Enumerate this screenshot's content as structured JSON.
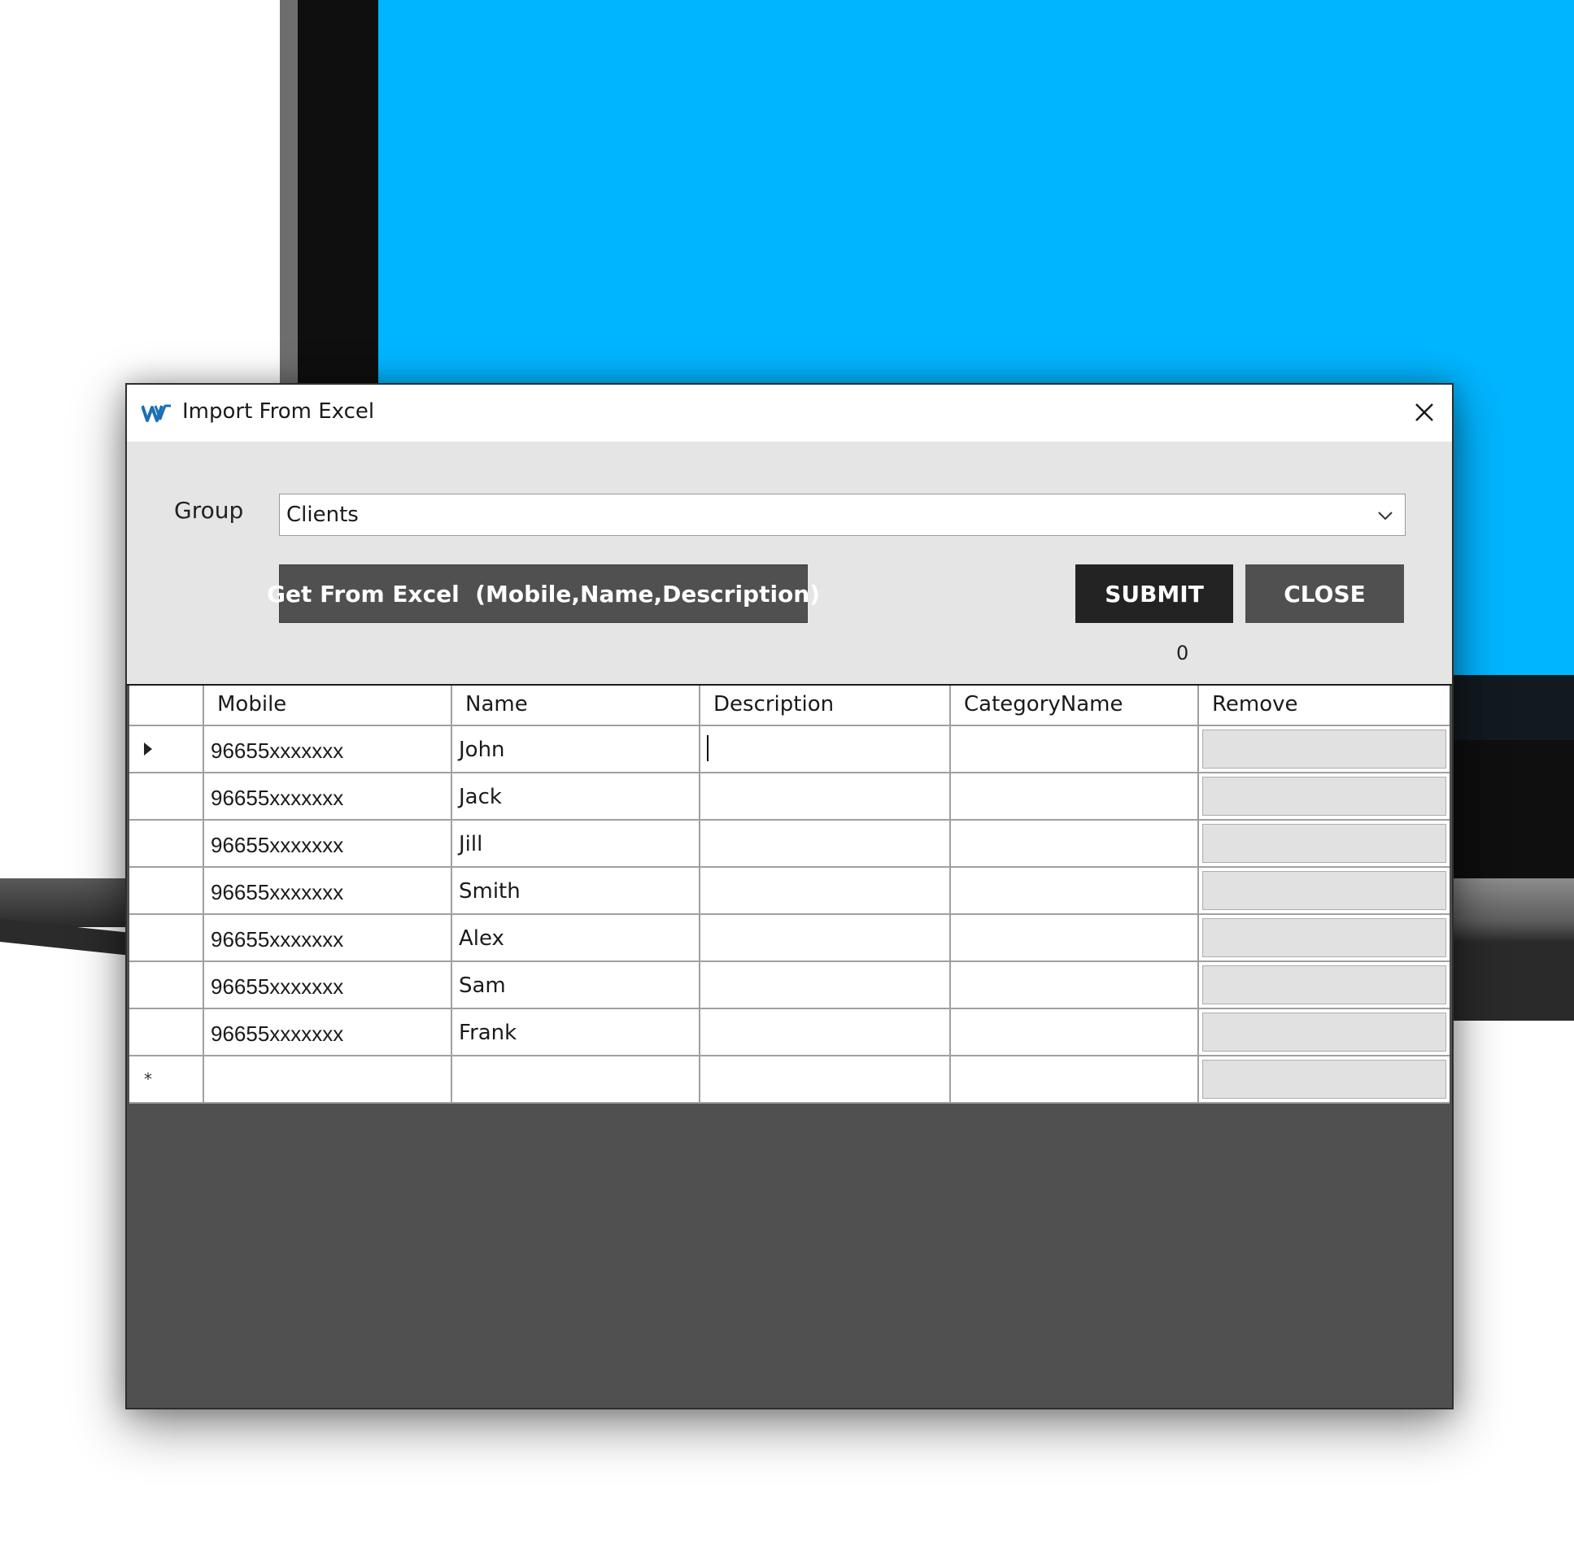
{
  "window": {
    "title": "Import From Excel",
    "app_icon": "ww-logo-icon",
    "close_icon": "close-icon"
  },
  "group": {
    "label": "Group",
    "selected": "Clients"
  },
  "buttons": {
    "get_from_excel": "Get From Excel  (Mobile,Name,Description)",
    "submit": "SUBMIT",
    "close": "CLOSE"
  },
  "counter": "0",
  "grid": {
    "columns": [
      "Mobile",
      "Name",
      "Description",
      "CategoryName",
      "Remove"
    ],
    "rows": [
      {
        "mobile": "96655xxxxxxx",
        "name": "John",
        "description": "",
        "category": ""
      },
      {
        "mobile": "96655xxxxxxx",
        "name": "Jack",
        "description": "",
        "category": ""
      },
      {
        "mobile": "96655xxxxxxx",
        "name": "Jill",
        "description": "",
        "category": ""
      },
      {
        "mobile": "96655xxxxxxx",
        "name": "Smith",
        "description": "",
        "category": ""
      },
      {
        "mobile": "96655xxxxxxx",
        "name": "Alex",
        "description": "",
        "category": ""
      },
      {
        "mobile": "96655xxxxxxx",
        "name": "Sam",
        "description": "",
        "category": ""
      },
      {
        "mobile": "96655xxxxxxx",
        "name": "Frank",
        "description": "",
        "category": ""
      }
    ],
    "new_row_marker": "*"
  },
  "colors": {
    "screen_blue": "#00b5ff",
    "dialog_bg": "#e5e5e5",
    "button_dark": "#232323",
    "button_gray": "#505050",
    "grid_empty": "#505050",
    "logo_blue": "#1a6fb5"
  }
}
